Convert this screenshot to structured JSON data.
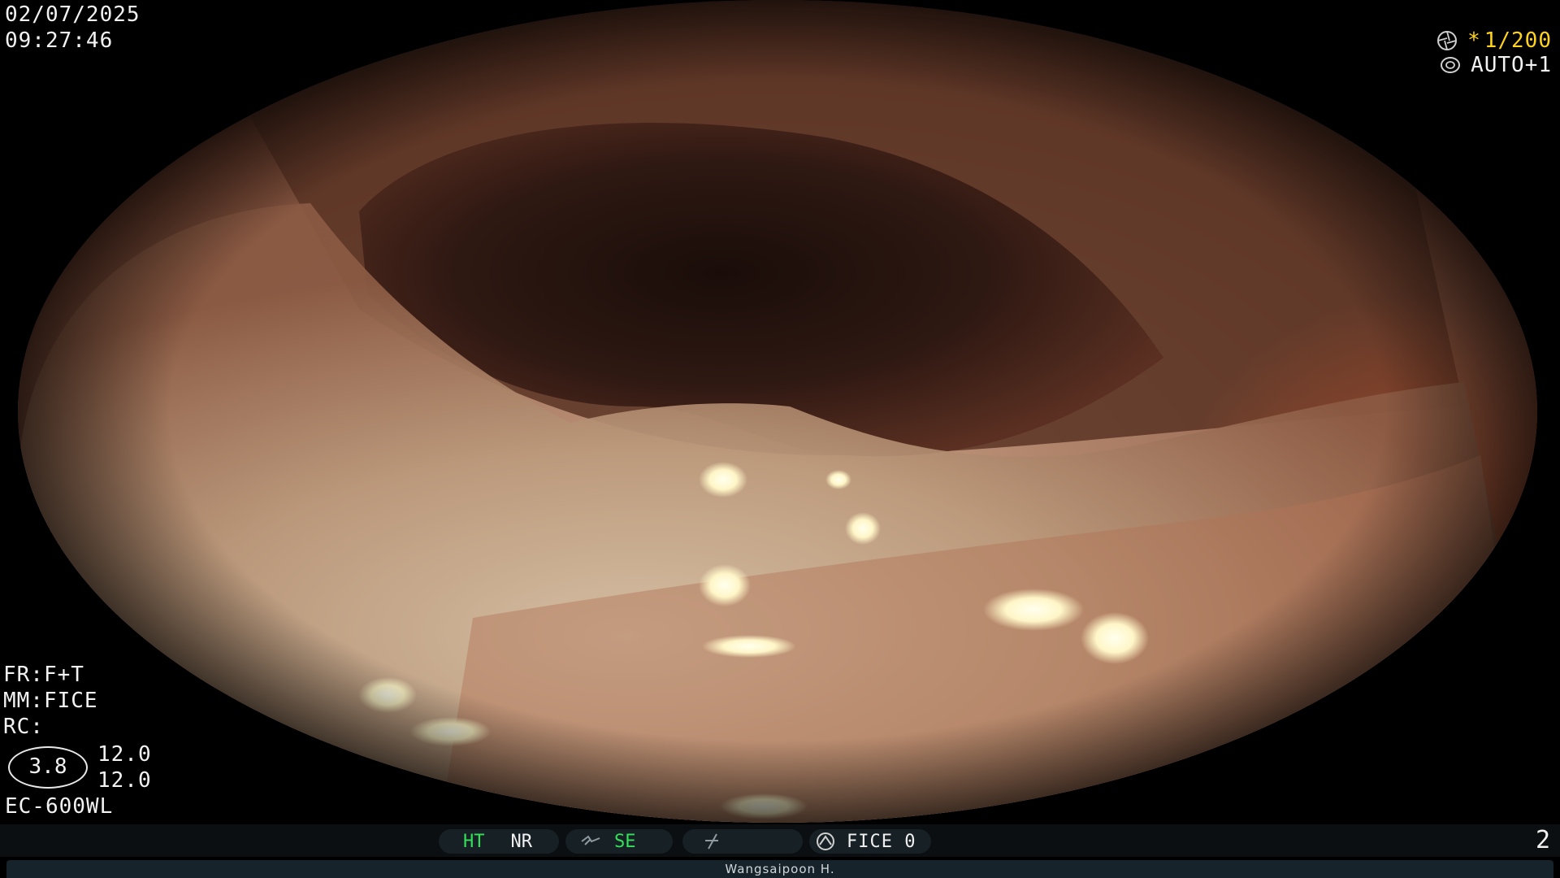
{
  "overlay": {
    "date": "02/07/2025",
    "time": "09:27:46",
    "shutter_star": "*",
    "shutter_speed": "1/200",
    "iris_mode": "AUTO+1",
    "frame_label": "FR:F+T",
    "mode_label": "MM:FICE",
    "rc_label": "RC:",
    "ratio_value": "3.8",
    "value_1": "12.0",
    "value_2": "12.0",
    "scope_model": "EC-600WL",
    "page_number": "2"
  },
  "status_bar": {
    "ht": "HT",
    "nr": "NR",
    "se": "SE",
    "fice": "FICE 0",
    "operator": "Wangsaipoon H."
  },
  "colors": {
    "accent_yellow": "#ffd21c",
    "status_green": "#34e05a",
    "bar_background": "#0b0f12",
    "pill_background": "#172125"
  },
  "icons": {
    "shutter": "shutter-icon",
    "iris": "iris-icon",
    "structure_enhance": "se-icon",
    "filter": "filter-icon",
    "fice": "fice-icon"
  }
}
